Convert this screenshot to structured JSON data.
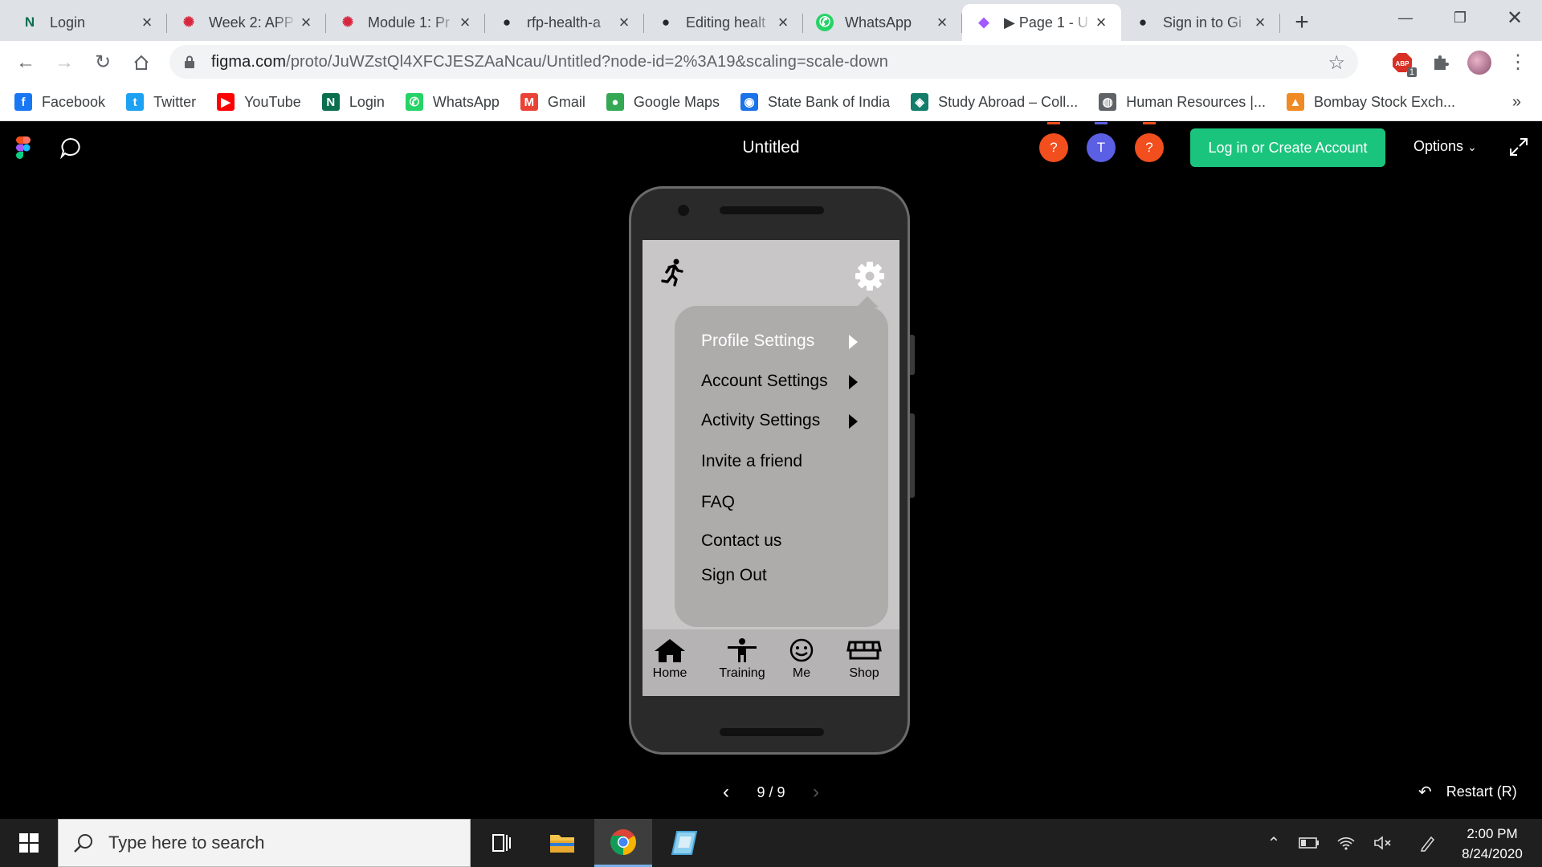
{
  "browser": {
    "tabs": [
      {
        "title": "Login",
        "icon": "notion-n-icon",
        "active": false
      },
      {
        "title": "Week 2: APP",
        "icon": "coursera-icon",
        "active": false
      },
      {
        "title": "Module 1: Pr",
        "icon": "coursera-icon",
        "active": false
      },
      {
        "title": "rfp-health-a",
        "icon": "github-icon",
        "active": false
      },
      {
        "title": "Editing healt",
        "icon": "github-icon",
        "active": false
      },
      {
        "title": "WhatsApp",
        "icon": "whatsapp-icon",
        "active": false
      },
      {
        "title": "▶ Page 1 - U",
        "icon": "figma-icon",
        "active": true
      },
      {
        "title": "Sign in to Gi",
        "icon": "github-icon",
        "active": false
      }
    ],
    "url_main": "figma.com",
    "url_path": "/proto/JuWZstQl4XFCJESZAaNcau/Untitled?node-id=2%3A19&scaling=scale-down",
    "extension_badge": "1",
    "bookmarks": [
      {
        "label": "Facebook",
        "icon": "facebook-icon",
        "color": "#1877f2"
      },
      {
        "label": "Twitter",
        "icon": "twitter-icon",
        "color": "#1da1f2"
      },
      {
        "label": "YouTube",
        "icon": "youtube-icon",
        "color": "#ff0000"
      },
      {
        "label": "Login",
        "icon": "notion-n-icon",
        "color": "#0b6e4f"
      },
      {
        "label": "WhatsApp",
        "icon": "whatsapp-icon",
        "color": "#25d366"
      },
      {
        "label": "Gmail",
        "icon": "gmail-icon",
        "color": "#ea4335"
      },
      {
        "label": "Google Maps",
        "icon": "maps-pin-icon",
        "color": "#34a853"
      },
      {
        "label": "State Bank of India",
        "icon": "sbi-icon",
        "color": "#1a73e8"
      },
      {
        "label": "Study Abroad – Coll...",
        "icon": "study-abroad-icon",
        "color": "#137c6a"
      },
      {
        "label": "Human Resources |...",
        "icon": "globe-icon",
        "color": "#5f6368"
      },
      {
        "label": "Bombay Stock Exch...",
        "icon": "bse-icon",
        "color": "#f08a24"
      }
    ]
  },
  "figma": {
    "file_title": "Untitled",
    "avatars": [
      {
        "label": "?",
        "color": "#f24e1e"
      },
      {
        "label": "T",
        "color": "#5b5fe3"
      },
      {
        "label": "?",
        "color": "#f24e1e"
      }
    ],
    "login_label": "Log in or Create Account",
    "options_label": "Options",
    "pager": "9 / 9",
    "restart_label": "Restart (R)",
    "accent": "#1bc47d"
  },
  "app": {
    "menu": [
      {
        "label": "Profile Settings",
        "arrow": true,
        "light": true
      },
      {
        "label": "Account Settings",
        "arrow": true,
        "light": false
      },
      {
        "label": "Activity Settings",
        "arrow": true,
        "light": false
      },
      {
        "label": "Invite a friend",
        "arrow": false,
        "light": false
      },
      {
        "label": "FAQ",
        "arrow": false,
        "light": false
      },
      {
        "label": "Contact us",
        "arrow": false,
        "light": false
      },
      {
        "label": "Sign Out",
        "arrow": false,
        "light": false
      }
    ],
    "nav": [
      {
        "label": "Home",
        "icon": "home-icon"
      },
      {
        "label": "Training",
        "icon": "training-icon"
      },
      {
        "label": "Me",
        "icon": "smiley-icon"
      },
      {
        "label": "Shop",
        "icon": "shop-icon"
      }
    ]
  },
  "taskbar": {
    "search_placeholder": "Type here to search",
    "time": "2:00 PM",
    "date": "8/24/2020"
  }
}
